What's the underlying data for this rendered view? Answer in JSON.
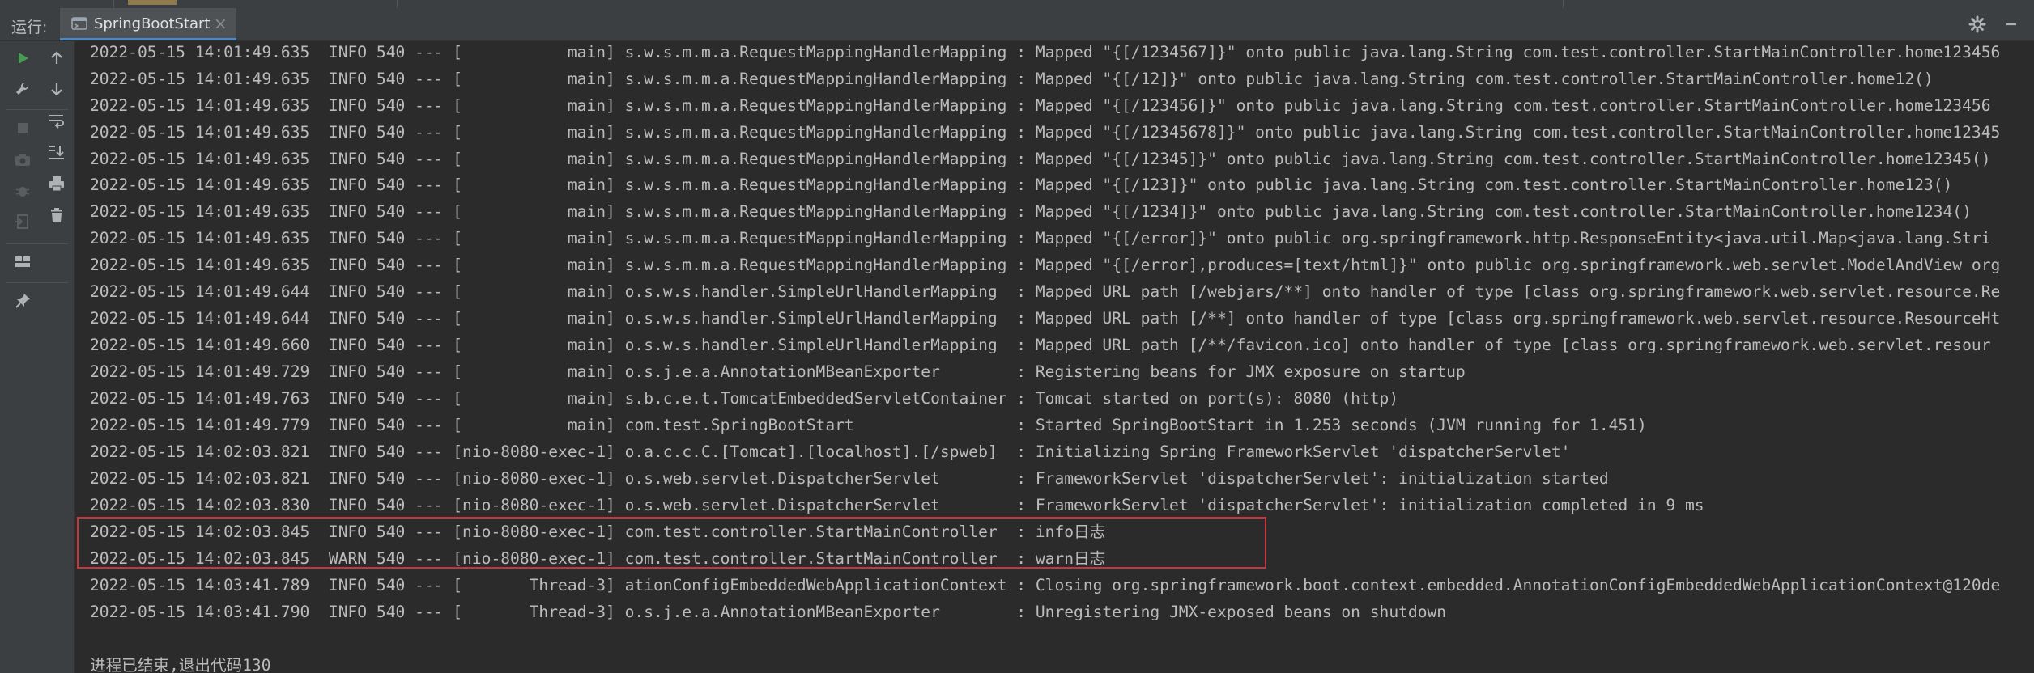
{
  "header": {
    "run_label": "运行:",
    "tab_label": "SpringBootStart",
    "tab_close": "×"
  },
  "toolbar": {
    "buttons": [
      {
        "icon": "play-icon",
        "enabled": true
      },
      {
        "icon": "arrow-up-icon",
        "enabled": true
      },
      {
        "icon": "wrench-icon",
        "enabled": true
      },
      {
        "icon": "arrow-down-icon",
        "enabled": true
      },
      {
        "icon": "stop-icon",
        "enabled": false
      },
      {
        "icon": "soft-wrap-icon",
        "enabled": true
      },
      {
        "icon": "camera-icon",
        "enabled": false
      },
      {
        "icon": "scroll-to-end-icon",
        "enabled": true
      },
      {
        "icon": "debug-bug-icon",
        "enabled": false
      },
      {
        "icon": "print-icon",
        "enabled": true
      },
      {
        "icon": "exit-icon",
        "enabled": false
      },
      {
        "icon": "trash-icon",
        "enabled": true
      },
      {
        "icon": "layout-icon",
        "enabled": true
      },
      {
        "icon": "pin-icon",
        "enabled": true
      }
    ]
  },
  "colors": {
    "background": "#2b2b2b",
    "panel": "#3c3f41",
    "text": "#bbbbbb",
    "accent_green": "#499c54",
    "highlight_red": "#c8353b",
    "tab_underline": "#4a88c7"
  },
  "console": {
    "lines": [
      "2022-05-15 14:01:49.635  INFO 540 --- [           main] s.w.s.m.m.a.RequestMappingHandlerMapping : Mapped \"{[/1234567]}\" onto public java.lang.String com.test.controller.StartMainController.home123456",
      "2022-05-15 14:01:49.635  INFO 540 --- [           main] s.w.s.m.m.a.RequestMappingHandlerMapping : Mapped \"{[/12]}\" onto public java.lang.String com.test.controller.StartMainController.home12()",
      "2022-05-15 14:01:49.635  INFO 540 --- [           main] s.w.s.m.m.a.RequestMappingHandlerMapping : Mapped \"{[/123456]}\" onto public java.lang.String com.test.controller.StartMainController.home123456",
      "2022-05-15 14:01:49.635  INFO 540 --- [           main] s.w.s.m.m.a.RequestMappingHandlerMapping : Mapped \"{[/12345678]}\" onto public java.lang.String com.test.controller.StartMainController.home12345",
      "2022-05-15 14:01:49.635  INFO 540 --- [           main] s.w.s.m.m.a.RequestMappingHandlerMapping : Mapped \"{[/12345]}\" onto public java.lang.String com.test.controller.StartMainController.home12345()",
      "2022-05-15 14:01:49.635  INFO 540 --- [           main] s.w.s.m.m.a.RequestMappingHandlerMapping : Mapped \"{[/123]}\" onto public java.lang.String com.test.controller.StartMainController.home123()",
      "2022-05-15 14:01:49.635  INFO 540 --- [           main] s.w.s.m.m.a.RequestMappingHandlerMapping : Mapped \"{[/1234]}\" onto public java.lang.String com.test.controller.StartMainController.home1234()",
      "2022-05-15 14:01:49.635  INFO 540 --- [           main] s.w.s.m.m.a.RequestMappingHandlerMapping : Mapped \"{[/error]}\" onto public org.springframework.http.ResponseEntity<java.util.Map<java.lang.Stri",
      "2022-05-15 14:01:49.635  INFO 540 --- [           main] s.w.s.m.m.a.RequestMappingHandlerMapping : Mapped \"{[/error],produces=[text/html]}\" onto public org.springframework.web.servlet.ModelAndView org",
      "2022-05-15 14:01:49.644  INFO 540 --- [           main] o.s.w.s.handler.SimpleUrlHandlerMapping  : Mapped URL path [/webjars/**] onto handler of type [class org.springframework.web.servlet.resource.Re",
      "2022-05-15 14:01:49.644  INFO 540 --- [           main] o.s.w.s.handler.SimpleUrlHandlerMapping  : Mapped URL path [/**] onto handler of type [class org.springframework.web.servlet.resource.ResourceHt",
      "2022-05-15 14:01:49.660  INFO 540 --- [           main] o.s.w.s.handler.SimpleUrlHandlerMapping  : Mapped URL path [/**/favicon.ico] onto handler of type [class org.springframework.web.servlet.resour",
      "2022-05-15 14:01:49.729  INFO 540 --- [           main] o.s.j.e.a.AnnotationMBeanExporter        : Registering beans for JMX exposure on startup",
      "2022-05-15 14:01:49.763  INFO 540 --- [           main] s.b.c.e.t.TomcatEmbeddedServletContainer : Tomcat started on port(s): 8080 (http)",
      "2022-05-15 14:01:49.779  INFO 540 --- [           main] com.test.SpringBootStart                 : Started SpringBootStart in 1.253 seconds (JVM running for 1.451)",
      "2022-05-15 14:02:03.821  INFO 540 --- [nio-8080-exec-1] o.a.c.c.C.[Tomcat].[localhost].[/spweb]  : Initializing Spring FrameworkServlet 'dispatcherServlet'",
      "2022-05-15 14:02:03.821  INFO 540 --- [nio-8080-exec-1] o.s.web.servlet.DispatcherServlet        : FrameworkServlet 'dispatcherServlet': initialization started",
      "2022-05-15 14:02:03.830  INFO 540 --- [nio-8080-exec-1] o.s.web.servlet.DispatcherServlet        : FrameworkServlet 'dispatcherServlet': initialization completed in 9 ms",
      "2022-05-15 14:02:03.845  INFO 540 --- [nio-8080-exec-1] com.test.controller.StartMainController  : info日志",
      "2022-05-15 14:02:03.845  WARN 540 --- [nio-8080-exec-1] com.test.controller.StartMainController  : warn日志",
      "2022-05-15 14:03:41.789  INFO 540 --- [       Thread-3] ationConfigEmbeddedWebApplicationContext : Closing org.springframework.boot.context.embedded.AnnotationConfigEmbeddedWebApplicationContext@120de",
      "2022-05-15 14:03:41.790  INFO 540 --- [       Thread-3] o.s.j.e.a.AnnotationMBeanExporter        : Unregistering JMX-exposed beans on shutdown"
    ],
    "exit_message": "进程已结束,退出代码130"
  }
}
